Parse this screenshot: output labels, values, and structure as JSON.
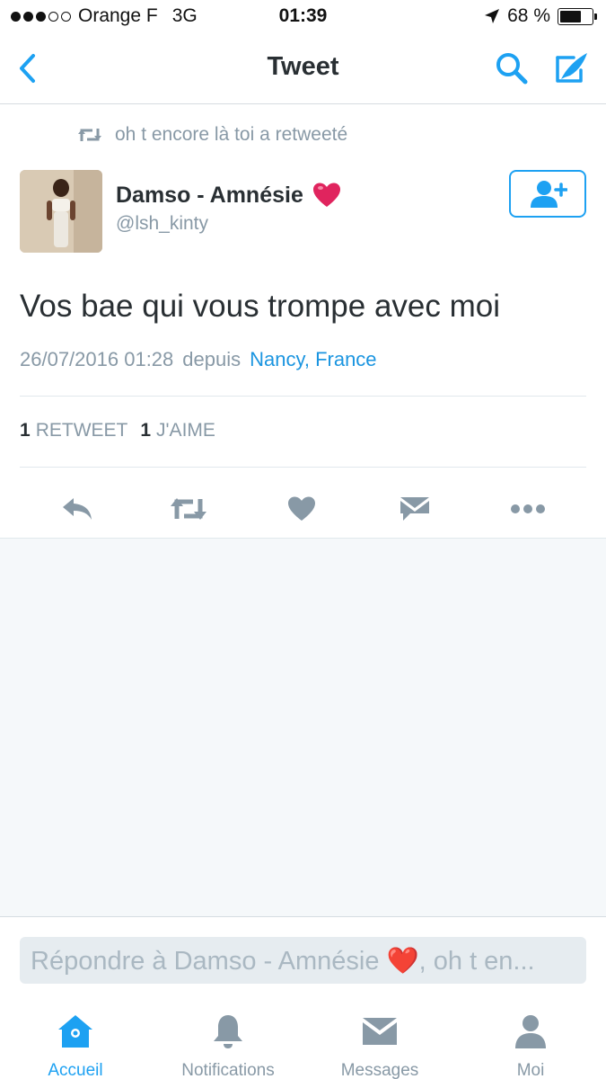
{
  "status_bar": {
    "carrier": "Orange F",
    "network": "3G",
    "time": "01:39",
    "battery": "68 %",
    "battery_level": 0.68
  },
  "nav": {
    "title": "Tweet"
  },
  "tweet": {
    "retweet_context": "oh t encore là toi a retweeté",
    "author_name": "Damso - Amnésie",
    "author_emoji": "❤️",
    "handle": "@lsh_kinty",
    "text": "Vos bae qui vous trompe avec moi",
    "timestamp": "26/07/2016 01:28",
    "from_label": "depuis",
    "place": "Nancy, France",
    "retweet_count": "1",
    "retweet_label": "RETWEET",
    "like_count": "1",
    "like_label": "J'AIME"
  },
  "reply": {
    "placeholder": "Répondre à Damso - Amnésie ❤️, oh t en..."
  },
  "tabs": [
    {
      "label": "Accueil",
      "icon": "home-icon",
      "active": true
    },
    {
      "label": "Notifications",
      "icon": "bell-icon",
      "active": false
    },
    {
      "label": "Messages",
      "icon": "envelope-icon",
      "active": false
    },
    {
      "label": "Moi",
      "icon": "person-icon",
      "active": false
    }
  ],
  "colors": {
    "accent": "#1da1f2",
    "link": "#1b95e0",
    "muted": "#8899a6",
    "action_icon": "#8899a6",
    "heart_emoji": "#e0245e"
  }
}
